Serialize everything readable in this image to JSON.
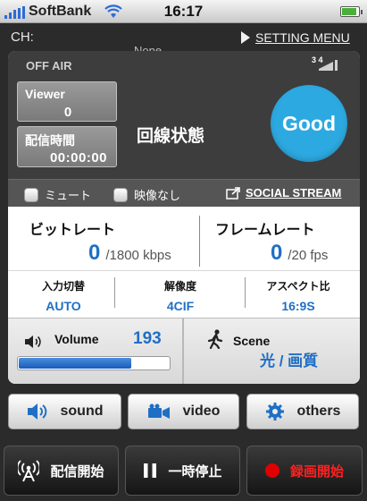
{
  "status_bar": {
    "carrier": "SoftBank",
    "time": "16:17",
    "battery_level": 0.9
  },
  "channel": {
    "label": "CH:",
    "name": "None"
  },
  "setting_menu_label": "SETTING MENU",
  "broadcast": {
    "state": "OFF AIR",
    "signal_badge": "3 4",
    "viewer_label": "Viewer",
    "viewer_count": "0",
    "duration_label": "配信時間",
    "duration": "00:00:00",
    "line_state_label": "回線状態",
    "line_quality": "Good"
  },
  "options": {
    "mute_label": "ミュート",
    "no_video_label": "映像なし",
    "social_stream_label": "SOCIAL STREAM"
  },
  "bitrate": {
    "title": "ビットレート",
    "value": "0",
    "limit": "/1800 kbps"
  },
  "framerate": {
    "title": "フレームレート",
    "value": "0",
    "limit": "/20 fps"
  },
  "settings_info": [
    {
      "label": "入力切替",
      "value": "AUTO"
    },
    {
      "label": "解像度",
      "value": "4CIF"
    },
    {
      "label": "アスペクト比",
      "value": "16:9S"
    }
  ],
  "volume": {
    "label": "Volume",
    "value": "193",
    "level": 0.75
  },
  "scene": {
    "label": "Scene",
    "value": "光 / 画質"
  },
  "tabs": {
    "sound": "sound",
    "video": "video",
    "others": "others"
  },
  "actions": {
    "start": "配信開始",
    "pause": "一時停止",
    "record": "録画開始"
  },
  "colors": {
    "accent": "#1f6fc5",
    "good": "#2ca9e1",
    "record": "#e10000"
  }
}
